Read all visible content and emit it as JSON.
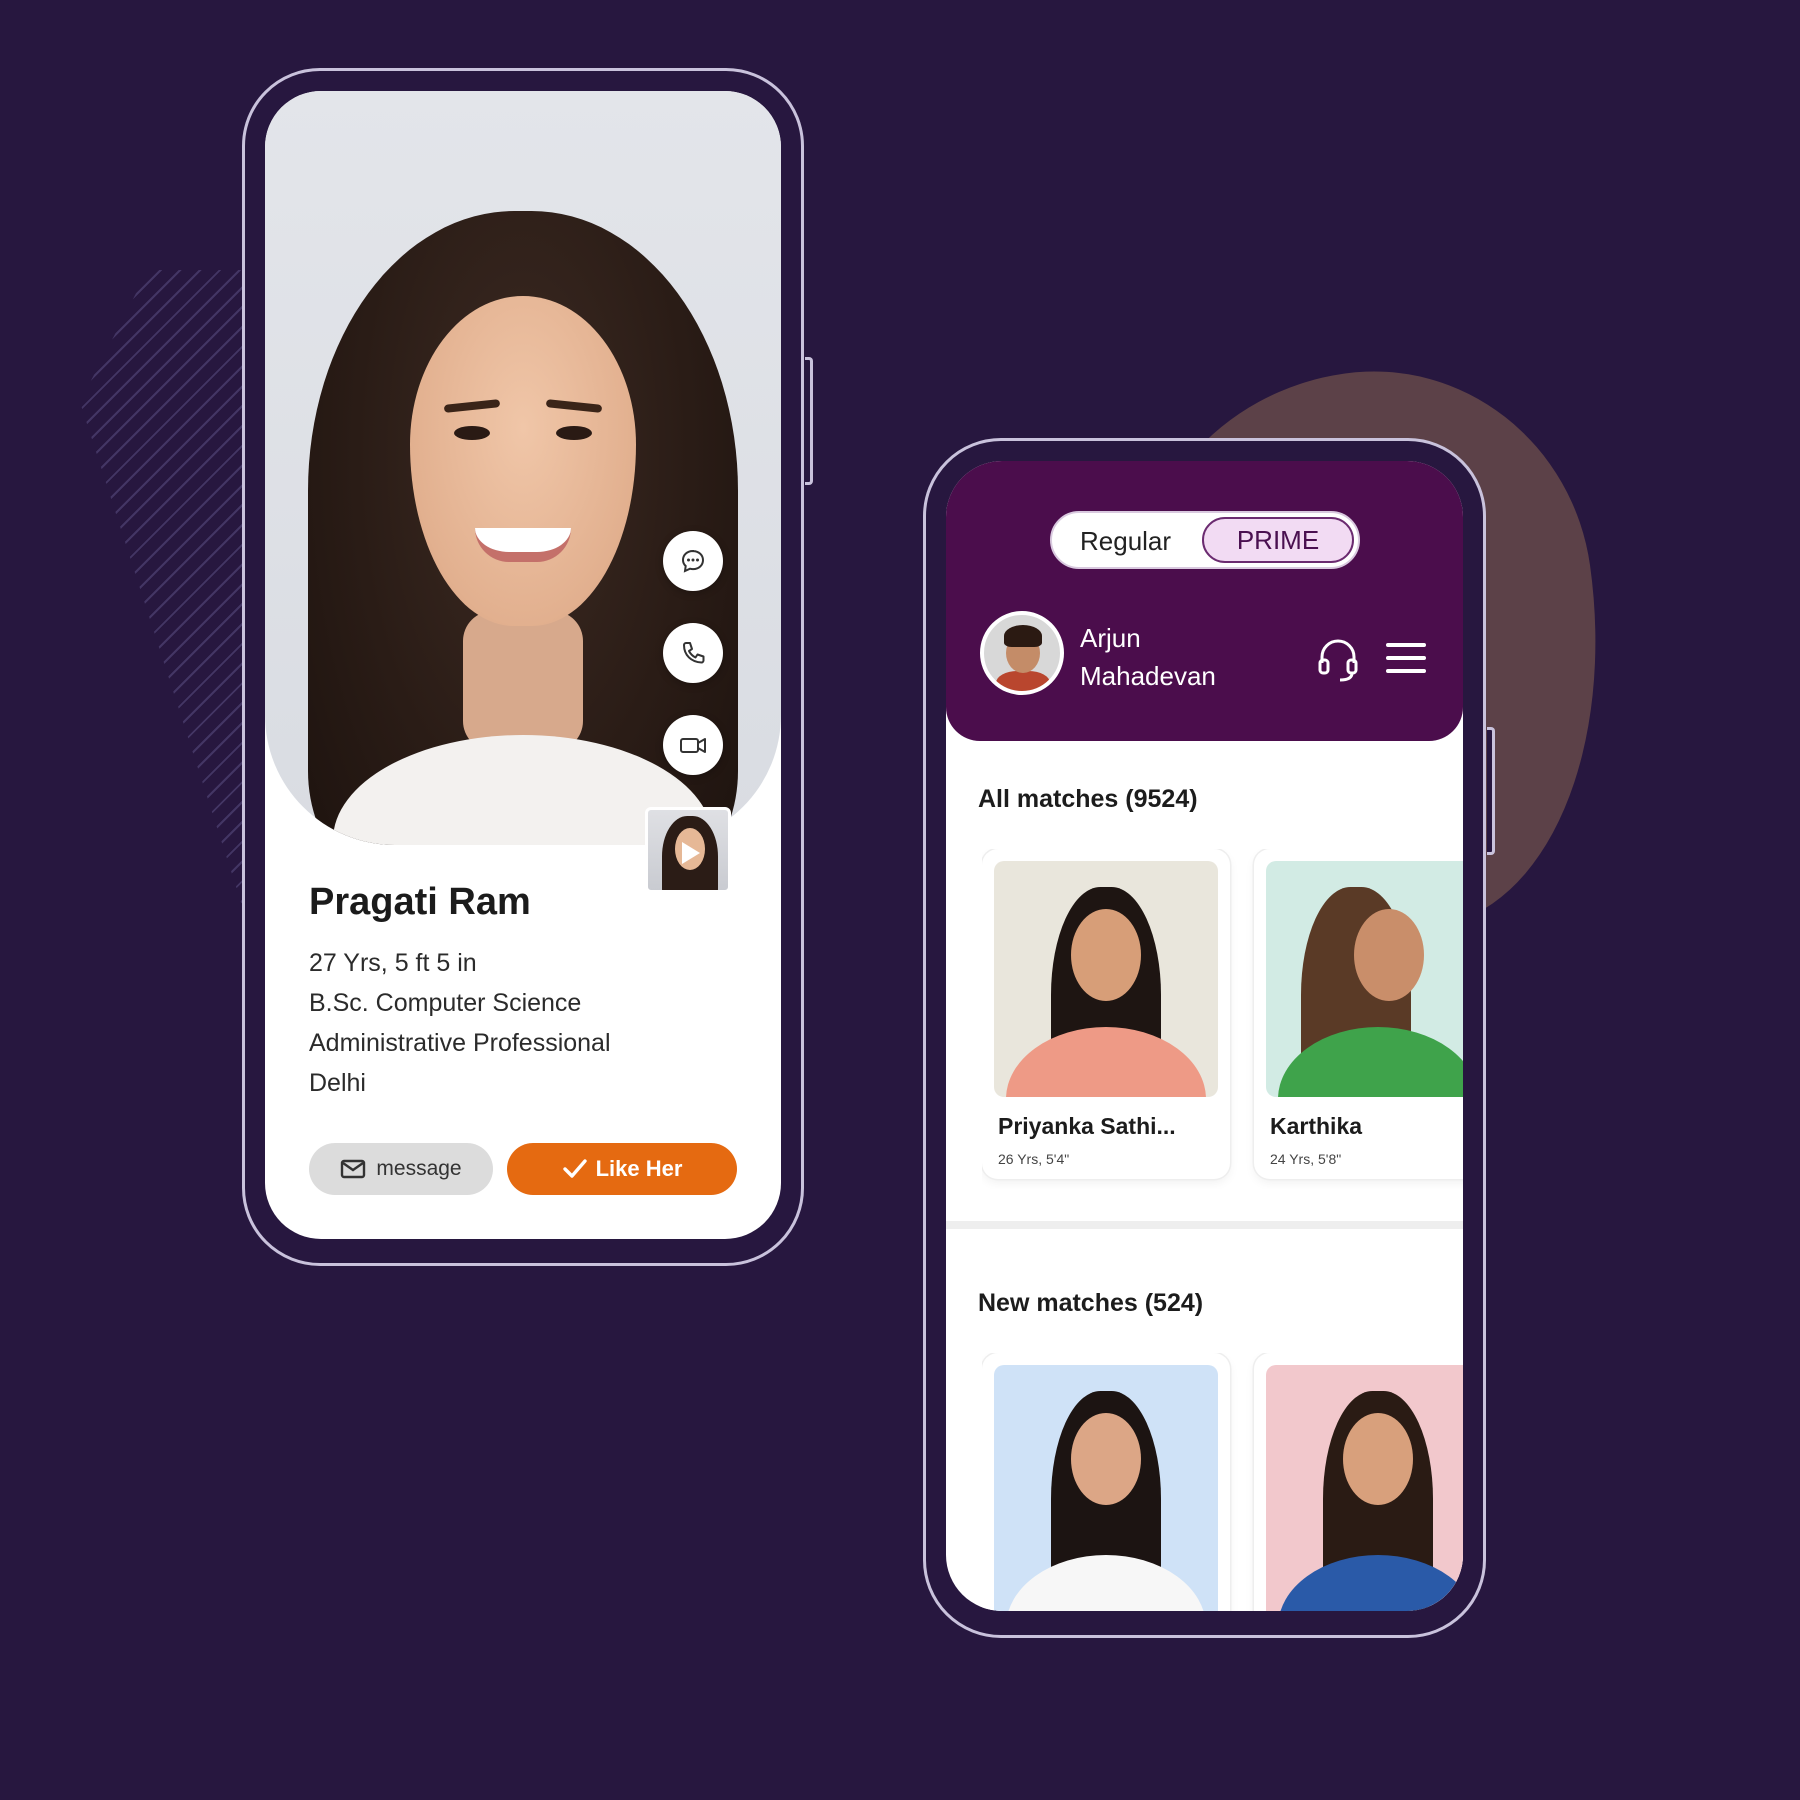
{
  "left_phone": {
    "profile": {
      "name": "Pragati Ram",
      "details": [
        "27 Yrs, 5 ft 5 in",
        "B.Sc. Computer Science",
        "Administrative Professional",
        "Delhi"
      ]
    },
    "actions": {
      "message_label": "message",
      "like_label": "Like Her"
    },
    "icons": [
      "chat-icon",
      "phone-icon",
      "video-icon",
      "play-icon",
      "mail-icon",
      "check-icon"
    ]
  },
  "right_phone": {
    "toggle": {
      "regular_label": "Regular",
      "prime_label": "PRIME",
      "selected": "PRIME"
    },
    "user": {
      "name_line1": "Arjun",
      "name_line2": "Mahadevan"
    },
    "sections": {
      "all_matches": {
        "title": "All matches (9524)",
        "cards": [
          {
            "name": "Priyanka Sathi...",
            "sub": "26 Yrs, 5'4\""
          },
          {
            "name": "Karthika",
            "sub": "24 Yrs, 5'8\""
          }
        ]
      },
      "new_matches": {
        "title": "New matches (524)"
      }
    },
    "icons": [
      "support-headset-icon",
      "hamburger-menu-icon"
    ]
  },
  "colors": {
    "background": "#27173f",
    "header_purple": "#4b0d4c",
    "like_orange": "#e56a11",
    "blob_brown": "#5c4148"
  }
}
